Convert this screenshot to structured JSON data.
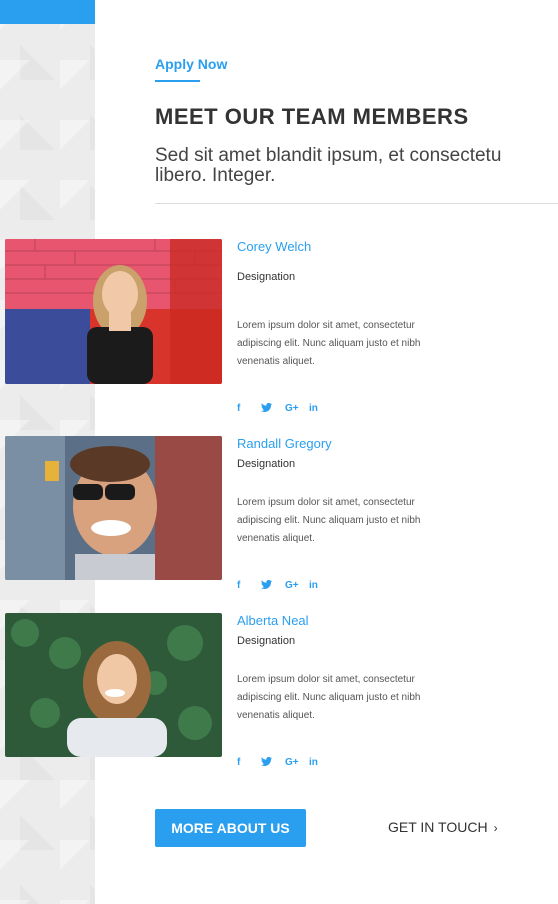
{
  "header": {
    "apply_label": "Apply Now",
    "title": "MEET OUR TEAM MEMBERS",
    "subtitle_line1": "Sed sit amet blandit ipsum, et consectetu",
    "subtitle_line2": "libero. Integer."
  },
  "members": [
    {
      "name": "Corey Welch",
      "designation": "Designation",
      "bio": "Lorem ipsum dolor sit amet, consectetur adipiscing elit. Nunc aliquam justo et nibh venenatis aliquet.",
      "socials": [
        "f",
        "→",
        "G+",
        "in"
      ]
    },
    {
      "name": "Randall Gregory",
      "designation": "Designation",
      "bio": "Lorem ipsum dolor sit amet, consectetur adipiscing elit. Nunc aliquam justo et nibh venenatis aliquet.",
      "socials": [
        "f",
        "→",
        "G+",
        "in"
      ]
    },
    {
      "name": "Alberta Neal",
      "designation": "Designation",
      "bio": "Lorem ipsum dolor sit amet, consectetur adipiscing elit. Nunc aliquam justo et nibh venenatis aliquet.",
      "socials": [
        "f",
        "→",
        "G+",
        "in"
      ]
    }
  ],
  "icons": {
    "facebook": "facebook-icon",
    "twitter": "twitter-icon",
    "googleplus": "google-plus-icon",
    "linkedin": "linkedin-icon"
  },
  "actions": {
    "more_label": "MORE ABOUT US",
    "touch_label": "GET IN TOUCH",
    "touch_chevron": "›"
  },
  "colors": {
    "accent": "#2a9ff0",
    "text": "#333333"
  }
}
